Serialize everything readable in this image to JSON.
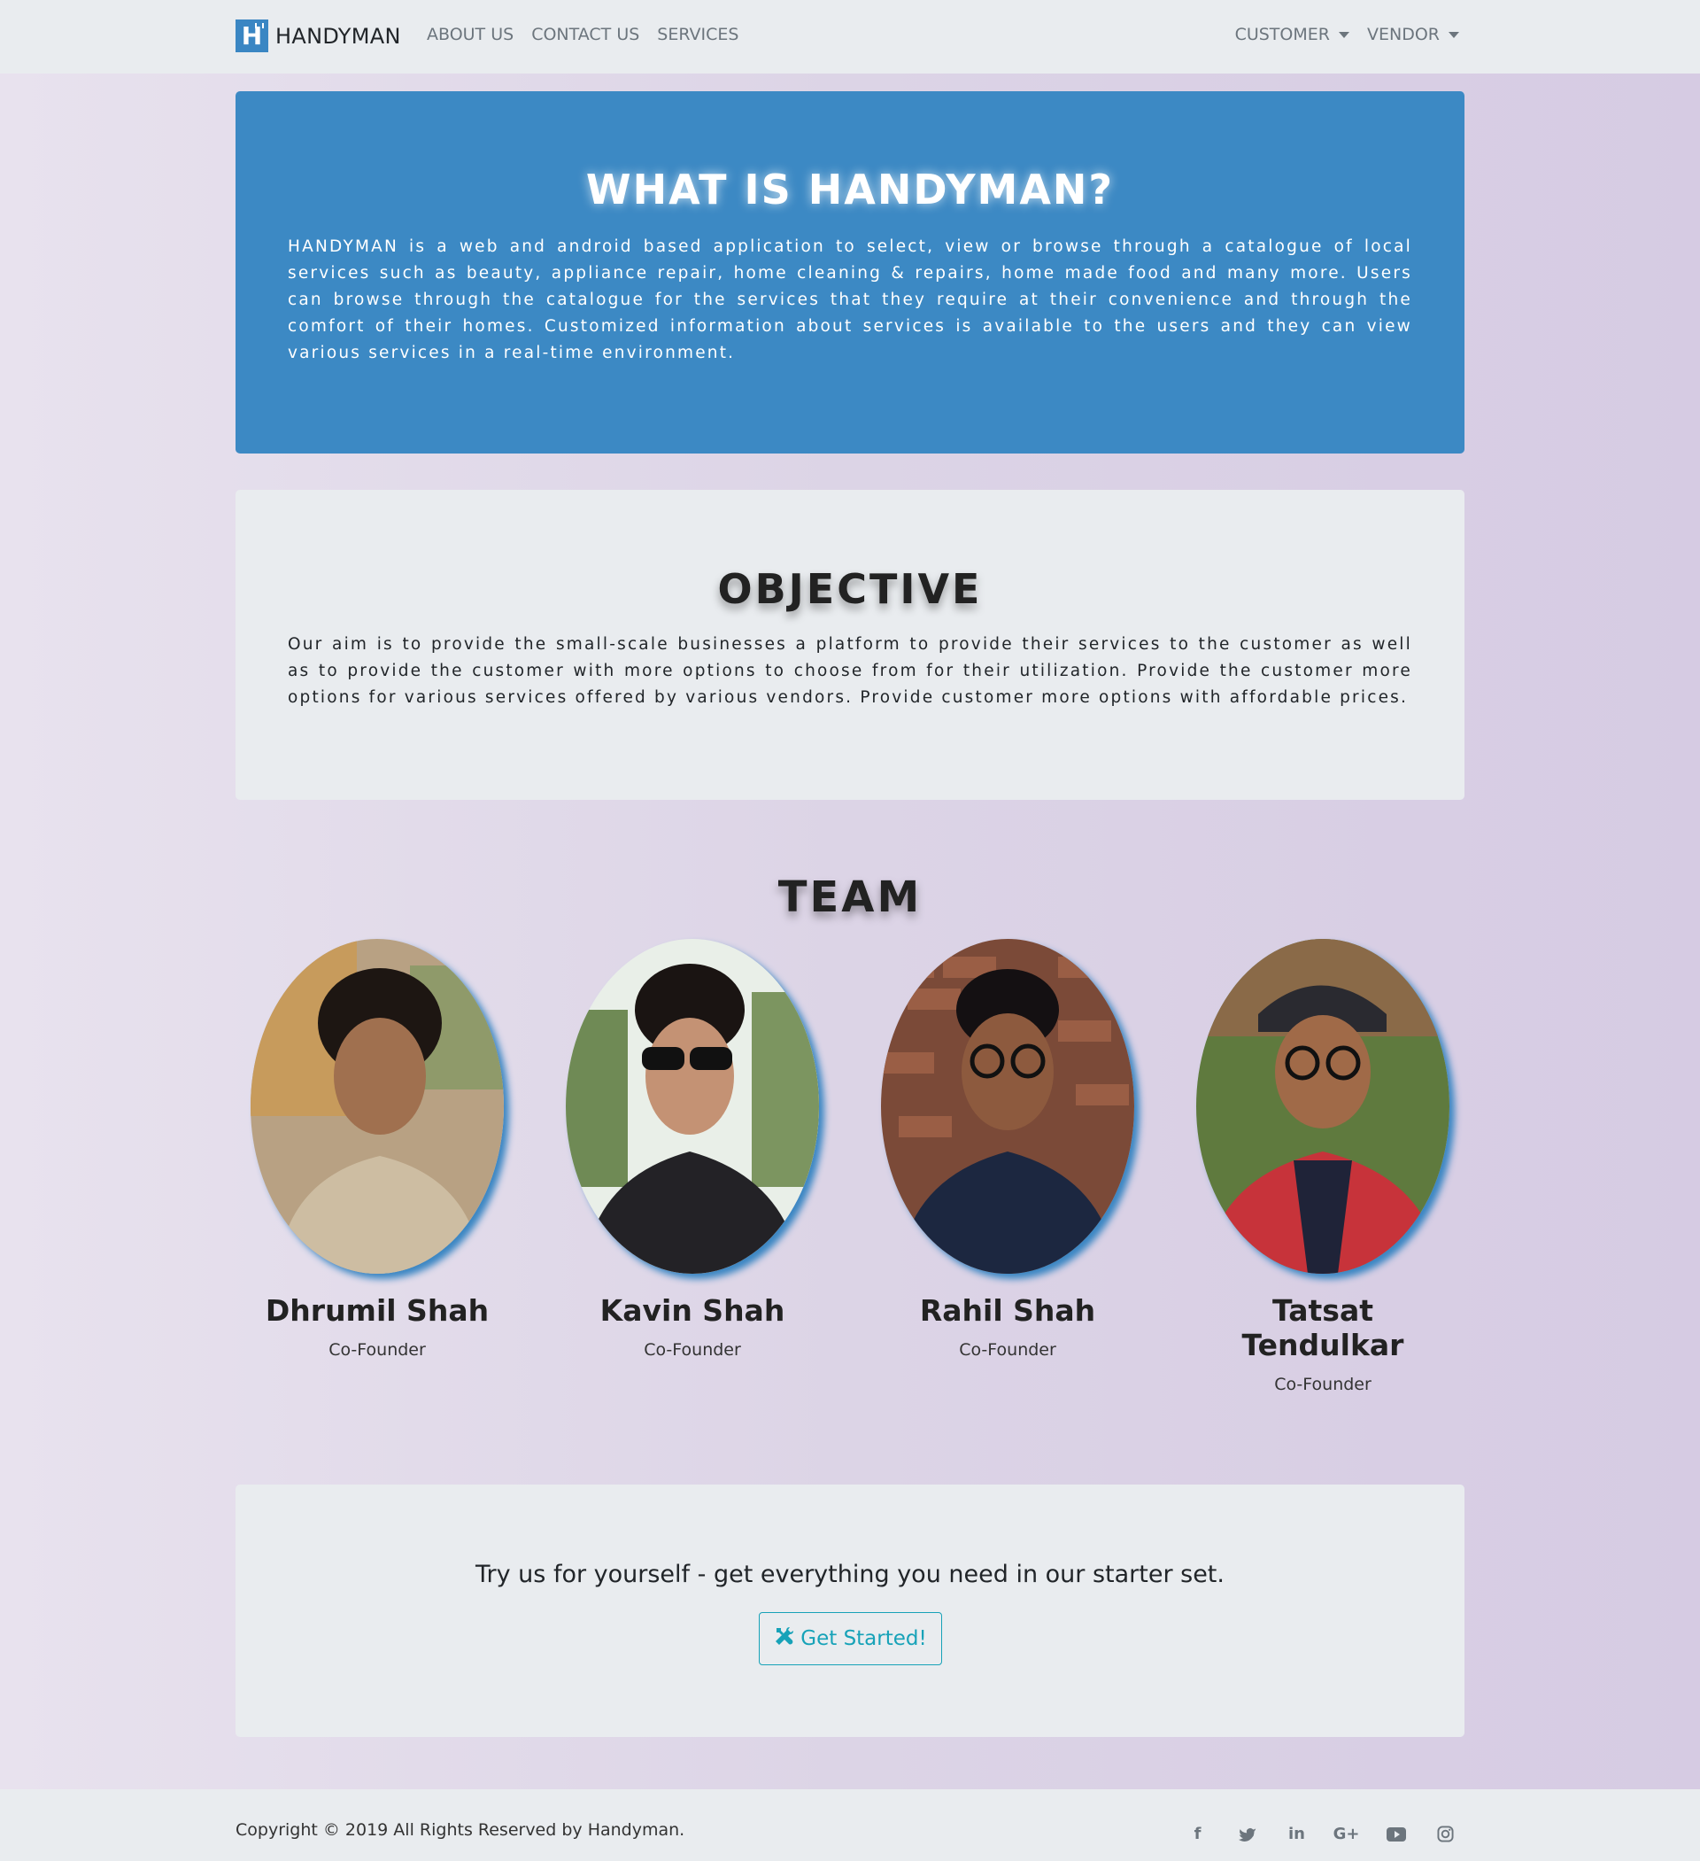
{
  "navbar": {
    "brand_text": "HANDYMAN",
    "links": [
      "ABOUT US",
      "CONTACT US",
      "SERVICES"
    ],
    "dropdowns": [
      "CUSTOMER",
      "VENDOR"
    ]
  },
  "what": {
    "title": "WHAT IS HANDYMAN?",
    "text": "HANDYMAN is a web and android based application to select, view or browse through a catalogue of local services such as beauty, appliance repair, home cleaning & repairs, home made food and many more. Users can browse through the catalogue for the services that they require at their convenience and through the comfort of their homes. Customized information about services is available to the users and they can view various services in a real-time environment."
  },
  "objective": {
    "title": "OBJECTIVE",
    "text": "Our aim is to provide the small-scale businesses a platform to provide their services to the customer as well as to provide the customer with more options to choose from for their utilization. Provide the customer more options for various services offered by various vendors. Provide customer more options with affordable prices."
  },
  "team": {
    "title": "TEAM",
    "members": [
      {
        "name": "Dhrumil Shah",
        "role": "Co-Founder"
      },
      {
        "name": "Kavin Shah",
        "role": "Co-Founder"
      },
      {
        "name": "Rahil Shah",
        "role": "Co-Founder"
      },
      {
        "name": "Tatsat Tendulkar",
        "role": "Co-Founder"
      }
    ]
  },
  "cta": {
    "heading": "Try us for yourself - get everything you need in our starter set.",
    "button_label": "Get Started!",
    "button_icon": "tools-icon"
  },
  "footer": {
    "copyright": "Copyright © 2019 All Rights Reserved by Handyman.",
    "socials": [
      "facebook-icon",
      "twitter-icon",
      "linkedin-icon",
      "google-plus-icon",
      "youtube-icon",
      "instagram-icon"
    ]
  },
  "colors": {
    "brand_blue": "#3c89c4",
    "accent_teal": "#17a2b8",
    "nav_bg": "#e9ecef"
  }
}
